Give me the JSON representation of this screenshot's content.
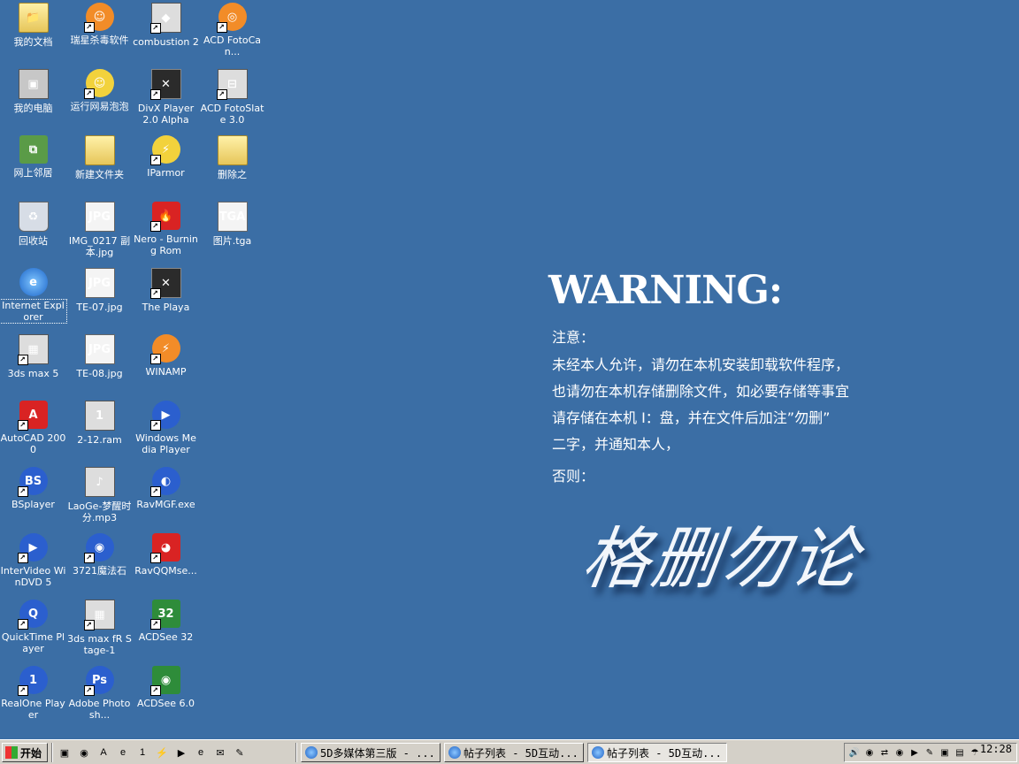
{
  "desktop_icons": [
    {
      "label": "我的文档",
      "icon": "documents-folder-icon",
      "glyph": "📁",
      "cls": "g-folder",
      "col": 0,
      "row": 0,
      "shortcut": false
    },
    {
      "label": "我的电脑",
      "icon": "computer-icon",
      "glyph": "▣",
      "cls": "g-pc",
      "col": 0,
      "row": 1,
      "shortcut": false
    },
    {
      "label": "网上邻居",
      "icon": "network-icon",
      "glyph": "⧉",
      "cls": "g-net",
      "col": 0,
      "row": 2,
      "shortcut": false
    },
    {
      "label": "回收站",
      "icon": "recycle-bin-icon",
      "glyph": "♻",
      "cls": "g-bin",
      "col": 0,
      "row": 3,
      "shortcut": false
    },
    {
      "label": "Internet Explorer",
      "icon": "internet-explorer-icon",
      "glyph": "e",
      "cls": "g-ie",
      "col": 0,
      "row": 4,
      "shortcut": false,
      "selected": true
    },
    {
      "label": "3ds max 5",
      "icon": "3ds-max-icon",
      "glyph": "▦",
      "cls": "g-app",
      "col": 0,
      "row": 5,
      "shortcut": true
    },
    {
      "label": "AutoCAD 2000",
      "icon": "autocad-icon",
      "glyph": "A",
      "cls": "g-red",
      "col": 0,
      "row": 6,
      "shortcut": true
    },
    {
      "label": "BSplayer",
      "icon": "bsplayer-icon",
      "glyph": "BS",
      "cls": "g-blue",
      "col": 0,
      "row": 7,
      "shortcut": true
    },
    {
      "label": "InterVideo WinDVD 5",
      "icon": "windvd-icon",
      "glyph": "▶",
      "cls": "g-blue",
      "col": 0,
      "row": 8,
      "shortcut": true
    },
    {
      "label": "QuickTime Player",
      "icon": "quicktime-icon",
      "glyph": "Q",
      "cls": "g-blue",
      "col": 0,
      "row": 9,
      "shortcut": true
    },
    {
      "label": "RealOne Player",
      "icon": "realone-icon",
      "glyph": "1",
      "cls": "g-blue",
      "col": 0,
      "row": 10,
      "shortcut": true
    },
    {
      "label": "瑞星杀毒软件",
      "icon": "rising-antivirus-icon",
      "glyph": "☺",
      "cls": "g-orange",
      "col": 1,
      "row": 0,
      "shortcut": true
    },
    {
      "label": "运行网易泡泡",
      "icon": "netease-popo-icon",
      "glyph": "☺",
      "cls": "g-yellow",
      "col": 1,
      "row": 1,
      "shortcut": true
    },
    {
      "label": "新建文件夹",
      "icon": "new-folder-icon",
      "glyph": "",
      "cls": "g-folder",
      "col": 1,
      "row": 2,
      "shortcut": false
    },
    {
      "label": "IMG_0217 副本.jpg",
      "icon": "jpg-file-icon",
      "glyph": "JPG",
      "cls": "g-jpg",
      "col": 1,
      "row": 3,
      "shortcut": false
    },
    {
      "label": "TE-07.jpg",
      "icon": "jpg-file-icon",
      "glyph": "JPG",
      "cls": "g-jpg",
      "col": 1,
      "row": 4,
      "shortcut": false
    },
    {
      "label": "TE-08.jpg",
      "icon": "jpg-file-icon",
      "glyph": "JPG",
      "cls": "g-jpg",
      "col": 1,
      "row": 5,
      "shortcut": false
    },
    {
      "label": "2-12.ram",
      "icon": "ram-file-icon",
      "glyph": "1",
      "cls": "g-app",
      "col": 1,
      "row": 6,
      "shortcut": false
    },
    {
      "label": "LaoGe-梦醒时分.mp3",
      "icon": "mp3-file-icon",
      "glyph": "♪",
      "cls": "g-app",
      "col": 1,
      "row": 7,
      "shortcut": false
    },
    {
      "label": "3721魔法石",
      "icon": "3721-icon",
      "glyph": "◉",
      "cls": "g-blue",
      "col": 1,
      "row": 8,
      "shortcut": true
    },
    {
      "label": "3ds max fR Stage-1",
      "icon": "3ds-max-icon",
      "glyph": "▦",
      "cls": "g-app",
      "col": 1,
      "row": 9,
      "shortcut": true
    },
    {
      "label": "Adobe Photosh...",
      "icon": "photoshop-icon",
      "glyph": "Ps",
      "cls": "g-blue",
      "col": 1,
      "row": 10,
      "shortcut": true
    },
    {
      "label": "combustion 2",
      "icon": "combustion-icon",
      "glyph": "◆",
      "cls": "g-app",
      "col": 2,
      "row": 0,
      "shortcut": true
    },
    {
      "label": "DivX Player 2.0 Alpha",
      "icon": "divx-icon",
      "glyph": "✕",
      "cls": "g-dark",
      "col": 2,
      "row": 1,
      "shortcut": true
    },
    {
      "label": "IParmor",
      "icon": "iparmor-icon",
      "glyph": "⚡",
      "cls": "g-yellow",
      "col": 2,
      "row": 2,
      "shortcut": true
    },
    {
      "label": "Nero - Burning Rom",
      "icon": "nero-icon",
      "glyph": "🔥",
      "cls": "g-red",
      "col": 2,
      "row": 3,
      "shortcut": true
    },
    {
      "label": "The Playa",
      "icon": "the-playa-icon",
      "glyph": "✕",
      "cls": "g-dark",
      "col": 2,
      "row": 4,
      "shortcut": true
    },
    {
      "label": "WINAMP",
      "icon": "winamp-icon",
      "glyph": "⚡",
      "cls": "g-orange",
      "col": 2,
      "row": 5,
      "shortcut": true
    },
    {
      "label": "Windows Media Player",
      "icon": "media-player-icon",
      "glyph": "▶",
      "cls": "g-blue",
      "col": 2,
      "row": 6,
      "shortcut": true
    },
    {
      "label": "RavMGF.exe",
      "icon": "ravmgf-icon",
      "glyph": "◐",
      "cls": "g-blue",
      "col": 2,
      "row": 7,
      "shortcut": true
    },
    {
      "label": "RavQQMse...",
      "icon": "ravqq-icon",
      "glyph": "◕",
      "cls": "g-red",
      "col": 2,
      "row": 8,
      "shortcut": true
    },
    {
      "label": "ACDSee 32",
      "icon": "acdsee-icon",
      "glyph": "32",
      "cls": "g-green",
      "col": 2,
      "row": 9,
      "shortcut": true
    },
    {
      "label": "ACDSee 6.0",
      "icon": "acdsee-icon",
      "glyph": "◉",
      "cls": "g-green",
      "col": 2,
      "row": 10,
      "shortcut": true
    },
    {
      "label": "ACD FotoCan...",
      "icon": "fotocanvas-icon",
      "glyph": "◎",
      "cls": "g-orange",
      "col": 3,
      "row": 0,
      "shortcut": true
    },
    {
      "label": "ACD FotoSlate 3.0",
      "icon": "fotoslate-icon",
      "glyph": "⊟",
      "cls": "g-app",
      "col": 3,
      "row": 1,
      "shortcut": true
    },
    {
      "label": "删除之",
      "icon": "folder-icon",
      "glyph": "",
      "cls": "g-folder",
      "col": 3,
      "row": 2,
      "shortcut": false
    },
    {
      "label": "图片.tga",
      "icon": "tga-file-icon",
      "glyph": "TGA",
      "cls": "g-jpg",
      "col": 3,
      "row": 3,
      "shortcut": false
    }
  ],
  "warning": {
    "title": "WARNING:",
    "lines": [
      "注意：",
      "未经本人允许，请勿在本机安装卸载软件程序，",
      "也请勿在本机存储删除文件，如必要存储等事宜",
      "请存储在本机 I：盘，并在文件后加注”勿删”",
      "二字，并通知本人，",
      "否则："
    ],
    "signature": "格删勿论"
  },
  "taskbar": {
    "start_label": "开始",
    "quick_launch": [
      {
        "icon": "show-desktop-icon",
        "glyph": "▣"
      },
      {
        "icon": "media-icon",
        "glyph": "◉"
      },
      {
        "icon": "autocad-icon",
        "glyph": "A"
      },
      {
        "icon": "ie-icon",
        "glyph": "e"
      },
      {
        "icon": "realone-icon",
        "glyph": "1"
      },
      {
        "icon": "winamp-icon",
        "glyph": "⚡"
      },
      {
        "icon": "media-player-icon",
        "glyph": "▶"
      },
      {
        "icon": "internet-explorer-icon",
        "glyph": "e"
      },
      {
        "icon": "outlook-icon",
        "glyph": "✉"
      },
      {
        "icon": "notepad-icon",
        "glyph": "✎"
      }
    ],
    "tasks": [
      {
        "label": "5D多媒体第三版 - ...",
        "active": false
      },
      {
        "label": "帖子列表 - 5D互动...",
        "active": false
      },
      {
        "label": "帖子列表 - 5D互动...",
        "active": true
      }
    ],
    "tray_icons": [
      {
        "icon": "volume-icon",
        "glyph": "🔊"
      },
      {
        "icon": "shield-icon",
        "glyph": "◉"
      },
      {
        "icon": "network-icon",
        "glyph": "⇄"
      },
      {
        "icon": "media-icon",
        "glyph": "◉"
      },
      {
        "icon": "play-icon",
        "glyph": "▶"
      },
      {
        "icon": "edit-icon",
        "glyph": "✎"
      },
      {
        "icon": "display-icon",
        "glyph": "▣"
      },
      {
        "icon": "input-method-icon",
        "glyph": "▤"
      },
      {
        "icon": "umbrella-icon",
        "glyph": "☂"
      }
    ],
    "clock": "12:28"
  }
}
